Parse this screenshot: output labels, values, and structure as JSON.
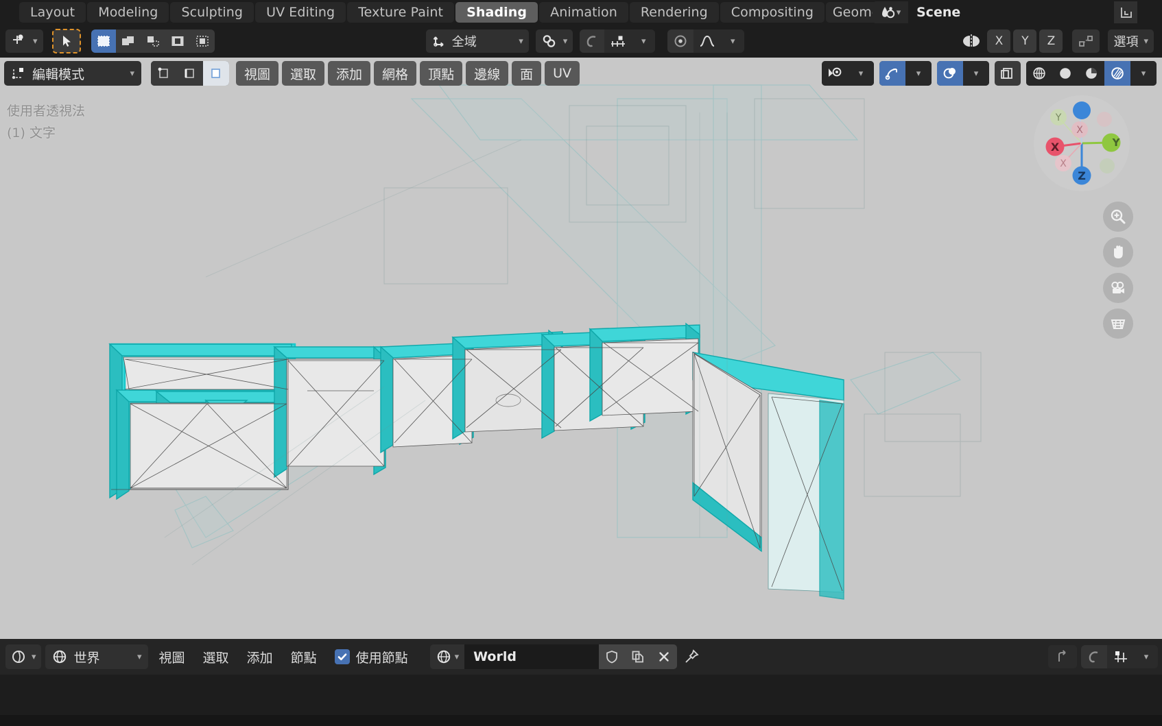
{
  "app": {
    "name": "Blender",
    "scene_name": "Scene"
  },
  "topbar": {
    "tabs": [
      {
        "label": "Layout",
        "active": false
      },
      {
        "label": "Modeling",
        "active": false
      },
      {
        "label": "Sculpting",
        "active": false
      },
      {
        "label": "UV Editing",
        "active": false
      },
      {
        "label": "Texture Paint",
        "active": false
      },
      {
        "label": "Shading",
        "active": true
      },
      {
        "label": "Animation",
        "active": false
      },
      {
        "label": "Rendering",
        "active": false
      },
      {
        "label": "Compositing",
        "active": false
      },
      {
        "label": "Geomet",
        "active": false
      }
    ],
    "scene_icon": "scene-data-icon",
    "scene_value": "Scene",
    "viewlayer_icon": "view-layer-icon"
  },
  "toolheader": {
    "editor_type_icon": "editor-type-3dview-icon",
    "cursor_tool_icon": "select-box-cursor-icon",
    "select_modes": [
      {
        "icon": "select-set-icon",
        "state": "active"
      },
      {
        "icon": "select-extend-icon",
        "state": "normal"
      },
      {
        "icon": "select-subtract-icon",
        "state": "normal"
      },
      {
        "icon": "select-invert-icon",
        "state": "normal"
      },
      {
        "icon": "select-intersect-icon",
        "state": "normal"
      }
    ],
    "transform_orientation": {
      "icon": "orientation-global-icon",
      "label": "全域"
    },
    "snap": {
      "icon": "snap-magnet-icon"
    },
    "proportional": {
      "icon": "proportional-edit-icon",
      "falloff_icon": "smooth-falloff-icon"
    },
    "mirror": {
      "icon": "mirror-icon",
      "axes": [
        "X",
        "Y",
        "Z"
      ],
      "topology_icon": "topology-mirror-icon"
    },
    "options": {
      "label": "選項"
    }
  },
  "viewport": {
    "mode": {
      "icon": "edit-mode-icon",
      "label": "編輯模式"
    },
    "mesh_select_modes": [
      {
        "icon": "vertex-select-icon",
        "active": false
      },
      {
        "icon": "edge-select-icon",
        "active": false
      },
      {
        "icon": "face-select-icon",
        "active": true
      }
    ],
    "menus": [
      "視圖",
      "選取",
      "添加",
      "網格",
      "頂點",
      "邊線",
      "面",
      "UV"
    ],
    "right_controls": [
      {
        "icon": "visibility-eye-icon",
        "has_chevron": true,
        "state": "normal"
      },
      {
        "icon": "gizmo-icon",
        "has_chevron": true,
        "state": "on"
      },
      {
        "icon": "overlays-icon",
        "has_chevron": true,
        "state": "on"
      },
      {
        "icon": "xray-toggle-icon",
        "has_chevron": false,
        "state": "normal"
      }
    ],
    "shading_modes": [
      {
        "icon": "shading-wireframe-icon",
        "active": false
      },
      {
        "icon": "shading-solid-icon",
        "active": false
      },
      {
        "icon": "shading-material-icon",
        "active": false
      },
      {
        "icon": "shading-rendered-icon",
        "active": true
      }
    ],
    "overlay_text": [
      "使用者透視法",
      "(1) 文字"
    ],
    "gizmo": {
      "axes": [
        {
          "label": "X",
          "color": "#e8536b",
          "positive": true
        },
        {
          "label": "Y",
          "color": "#8fc740",
          "positive": true
        },
        {
          "label": "Z",
          "color": "#3b86d8",
          "positive": true
        },
        {
          "label": "X",
          "color": "#e8a8b2",
          "positive": false
        },
        {
          "label": "Y",
          "color": "#c8dcaa",
          "positive": false
        },
        {
          "label": "Z",
          "color": "#b6cfe8",
          "positive": false
        }
      ]
    },
    "nav_buttons": [
      {
        "icon": "zoom-icon"
      },
      {
        "icon": "hand-pan-icon"
      },
      {
        "icon": "camera-view-icon"
      },
      {
        "icon": "ortho-perspective-grid-icon"
      }
    ],
    "colors": {
      "background": "#c8c8c8",
      "selected_edge": "#2ed8d8",
      "mesh_face": "#e3e3e3",
      "wire": "#4a4a4a"
    }
  },
  "shader_editor": {
    "editor_type_icon": "editor-type-shader-icon",
    "shader_type": {
      "icon": "world-globe-icon",
      "label": "世界"
    },
    "menus": [
      "視圖",
      "選取",
      "添加",
      "節點"
    ],
    "use_nodes": {
      "label": "使用節點",
      "checked": true
    },
    "datablock": {
      "icon": "world-globe-icon",
      "name": "World",
      "buttons": [
        "fake-user-shield-icon",
        "new-copy-icon",
        "unlink-x-icon"
      ],
      "pin_icon": "pin-icon"
    },
    "right_controls": [
      {
        "icon": "go-to-parent-icon"
      },
      {
        "icon": "snap-magnet-icon"
      },
      {
        "icon": "snap-target-icon",
        "has_chevron": true
      }
    ]
  }
}
